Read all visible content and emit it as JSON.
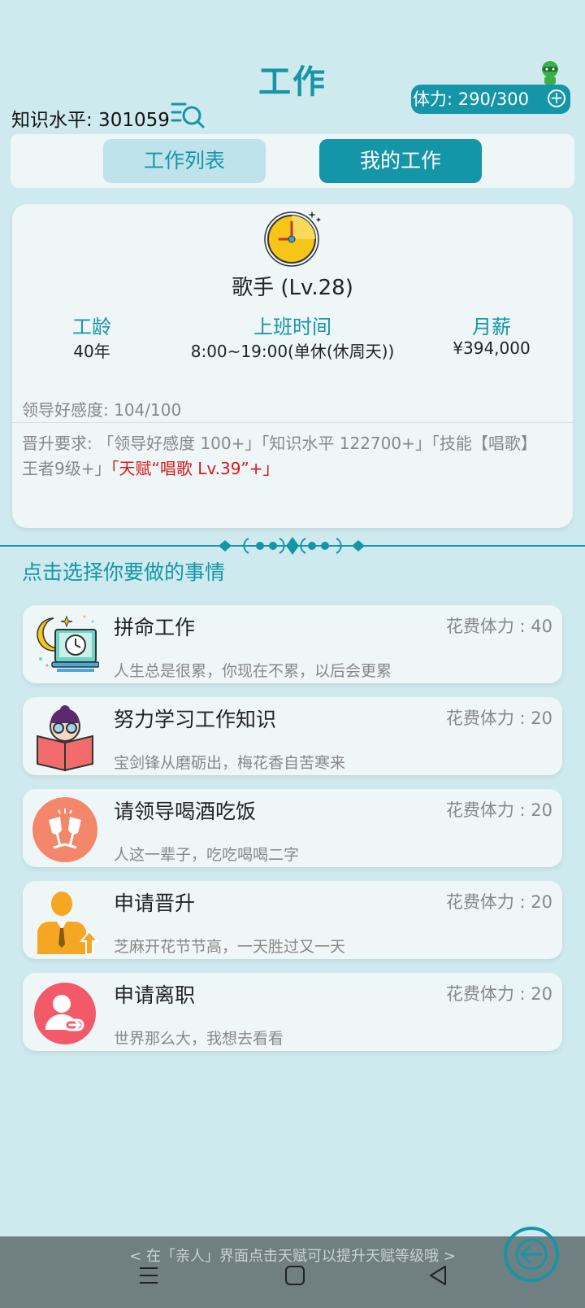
{
  "header": {
    "title": "工作",
    "knowledge": "知识水平: 301059",
    "stamina": "体力: 290/300"
  },
  "tabs": {
    "list_label": "工作列表",
    "mine_label": "我的工作"
  },
  "job": {
    "title": "歌手 (Lv.28)",
    "seniority_label": "工龄",
    "seniority_value": "40年",
    "hours_label": "上班时间",
    "hours_value": "8:00~19:00(单休(休周天))",
    "salary_label": "月薪",
    "salary_value": "¥394,000",
    "favor": "领导好感度: 104/100",
    "promotion_requirement": "晋升要求: 「领导好感度 100+」「知识水平 122700+」「技能【唱歌】王者9级+」",
    "promotion_talent": "「天赋“唱歌 Lv.39”+」"
  },
  "section_title": "点击选择你要做的事情",
  "actions": [
    {
      "name": "拼命工作",
      "cost": "花费体力 : 40",
      "desc": "人生总是很累，你现在不累，以后会更累",
      "icon": "night-work-icon"
    },
    {
      "name": "努力学习工作知识",
      "cost": "花费体力 : 20",
      "desc": "宝剑锋从磨砺出，梅花香自苦寒来",
      "icon": "study-book-icon"
    },
    {
      "name": "请领导喝酒吃饭",
      "cost": "花费体力 : 20",
      "desc": "人这一辈子，吃吃喝喝二字",
      "icon": "toast-glasses-icon"
    },
    {
      "name": "申请晋升",
      "cost": "花费体力 : 20",
      "desc": "芝麻开花节节高，一天胜过又一天",
      "icon": "promotion-person-icon"
    },
    {
      "name": "申请离职",
      "cost": "花费体力 : 20",
      "desc": "世界那么大，我想去看看",
      "icon": "resign-user-icon"
    }
  ],
  "footer_tip": "< 在「亲人」界面点击天赋可以提升天赋等级哦 >",
  "colors": {
    "accent": "#1496a8",
    "background": "#cfeaee",
    "card": "#eef6f8",
    "talent_red": "#d61a1a"
  }
}
